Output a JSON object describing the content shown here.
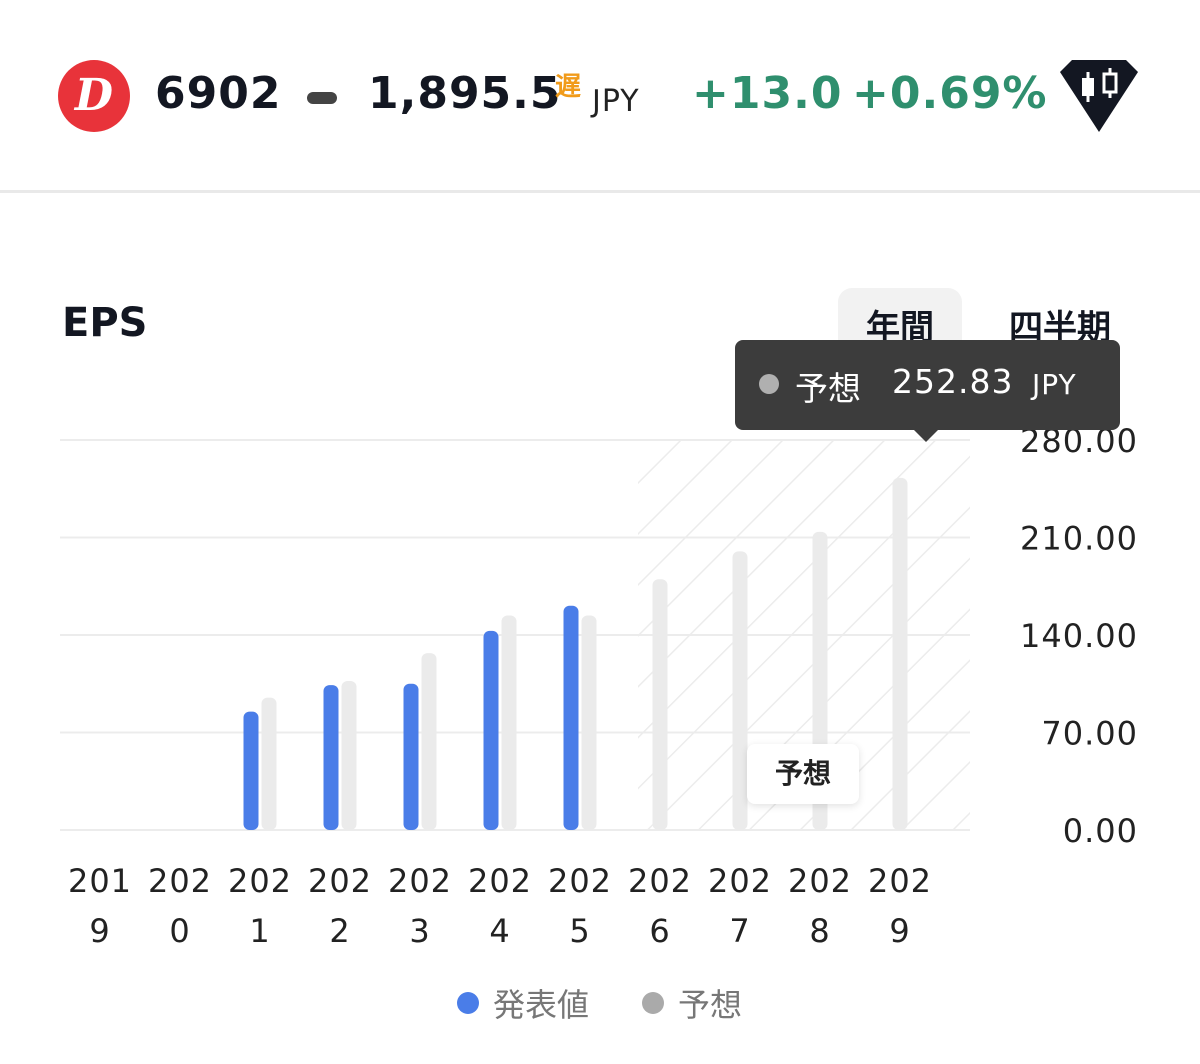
{
  "header": {
    "logo_letter": "D",
    "ticker": "6902",
    "price": "1,895.5",
    "delay_badge": "遅",
    "currency": "JPY",
    "change": "+13.0",
    "change_percent": "+0.69%",
    "colors": {
      "logo": "#e8333a",
      "positive": "#2f8f6e",
      "delay": "#f19b1a"
    },
    "brand_icon": "candlestick-diamond-icon"
  },
  "section": {
    "title": "EPS",
    "tabs": [
      {
        "label": "年間",
        "active": true
      },
      {
        "label": "四半期",
        "active": false
      }
    ]
  },
  "tooltip": {
    "series": "予想",
    "value": "252.83",
    "currency": "JPY"
  },
  "forecast_badge": "予想",
  "legend": [
    {
      "label": "発表値",
      "color": "#4a7de8"
    },
    {
      "label": "予想",
      "color": "#aaaaaa"
    }
  ],
  "chart_data": {
    "type": "bar",
    "title": "EPS",
    "categories": [
      "2019",
      "2020",
      "2021",
      "2022",
      "2023",
      "2024",
      "2025",
      "2026",
      "2027",
      "2028",
      "2029"
    ],
    "category_lines": [
      [
        "201",
        "9"
      ],
      [
        "202",
        "0"
      ],
      [
        "202",
        "1"
      ],
      [
        "202",
        "2"
      ],
      [
        "202",
        "3"
      ],
      [
        "202",
        "4"
      ],
      [
        "202",
        "5"
      ],
      [
        "202",
        "6"
      ],
      [
        "202",
        "7"
      ],
      [
        "202",
        "8"
      ],
      [
        "202",
        "9"
      ]
    ],
    "series": [
      {
        "name": "発表値",
        "color": "#4a7de8",
        "values": [
          null,
          null,
          85,
          104,
          105,
          143,
          161,
          null,
          null,
          null,
          null
        ]
      },
      {
        "name": "予想",
        "color": "#ebebeb",
        "values": [
          null,
          null,
          95,
          107,
          127,
          154,
          154,
          180,
          200,
          214,
          252.83
        ]
      }
    ],
    "yticks": [
      "0.00",
      "70.00",
      "140.00",
      "210.00",
      "280.00"
    ],
    "ylim": [
      0,
      280
    ],
    "grid": true,
    "y_axis_side": "right",
    "forecast_region_start": "2026",
    "legend_position": "bottom"
  }
}
